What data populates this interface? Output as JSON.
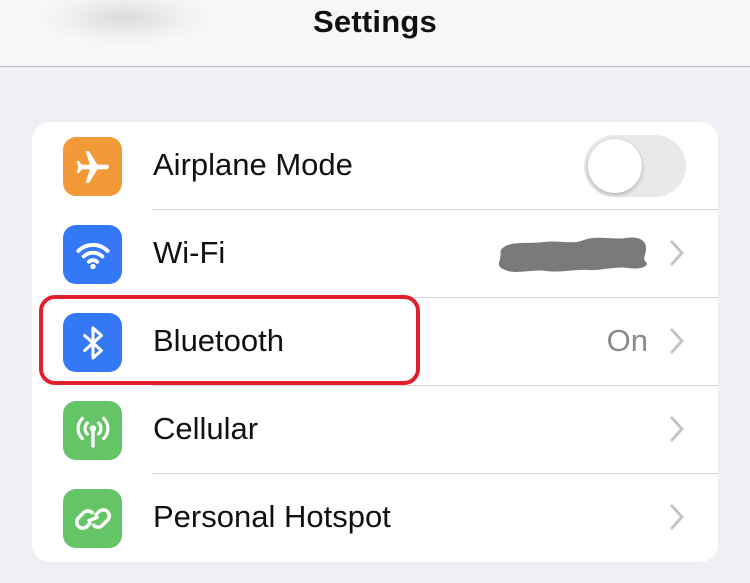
{
  "header": {
    "title": "Settings"
  },
  "settings_group": {
    "rows": [
      {
        "label": "Airplane Mode",
        "icon": "airplane-icon",
        "icon_color": "#f19a37",
        "control": "toggle",
        "toggle_on": false
      },
      {
        "label": "Wi-Fi",
        "icon": "wifi-icon",
        "icon_color": "#3478f6",
        "value_redacted": true
      },
      {
        "label": "Bluetooth",
        "icon": "bluetooth-icon",
        "icon_color": "#3478f6",
        "value": "On"
      },
      {
        "label": "Cellular",
        "icon": "cellular-antenna-icon",
        "icon_color": "#65c466"
      },
      {
        "label": "Personal Hotspot",
        "icon": "hotspot-link-icon",
        "icon_color": "#65c466"
      }
    ]
  },
  "annotation": {
    "highlight_color": "#e0202f",
    "highlighted_row": "Bluetooth"
  },
  "colors": {
    "background": "#f0eff5",
    "group_background": "#ffffff",
    "secondary_text": "#8a8a8e",
    "chevron": "#c4c4c7"
  }
}
